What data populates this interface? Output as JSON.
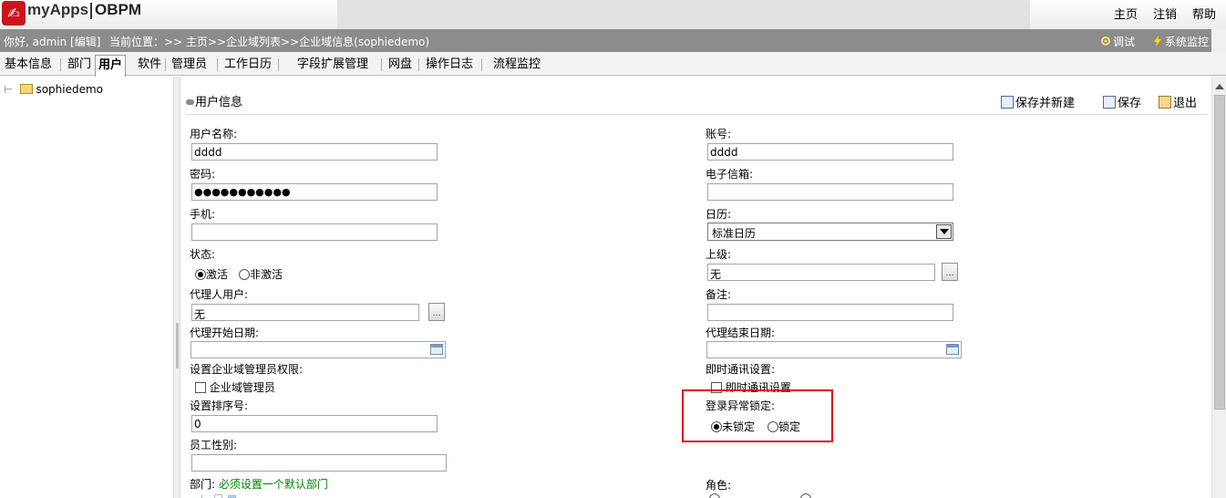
{
  "header": {
    "logo_text": "myApps",
    "product": "OBPM",
    "links": [
      "主页",
      "注销",
      "帮助"
    ]
  },
  "infobar": {
    "greeting": "你好, admin [编辑]",
    "location": "当前位置：>> 主页>>企业域列表>>企业域信息(sophiedemo)",
    "debug": "调试",
    "monitor": "系统监控"
  },
  "tabs": [
    "基本信息",
    "部门",
    "用户",
    "软件",
    "管理员",
    "工作日历",
    "字段扩展管理",
    "网盘",
    "操作日志",
    "流程监控"
  ],
  "active_tab": "用户",
  "tree": {
    "root": "sophiedemo"
  },
  "panel": {
    "title": "用户信息",
    "actions": {
      "save_new": "保存并新建",
      "save": "保存",
      "exit": "退出"
    }
  },
  "form": {
    "username_label": "用户名称:",
    "username_value": "dddd",
    "account_label": "账号:",
    "account_value": "dddd",
    "password_label": "密码:",
    "password_value": "●●●●●●●●●●●",
    "email_label": "电子信箱:",
    "email_value": "",
    "phone_label": "手机:",
    "phone_value": "",
    "calendar_label": "日历:",
    "calendar_value": "标准日历",
    "status_label": "状态:",
    "status_active": "激活",
    "status_inactive": "非激活",
    "superior_label": "上级:",
    "superior_value": "无",
    "proxy_label": "代理人用户:",
    "proxy_value": "无",
    "remark_label": "备注:",
    "remark_value": "",
    "proxy_start_label": "代理开始日期:",
    "proxy_end_label": "代理结束日期:",
    "domain_admin_perm_label": "设置企业域管理员权限:",
    "domain_admin_checkbox": "企业域管理员",
    "im_label": "即时通讯设置:",
    "im_checkbox": "即时通讯设置",
    "sort_label": "设置排序号:",
    "sort_value": "0",
    "lock_label": "登录异常锁定:",
    "lock_unlocked": "未锁定",
    "lock_locked": "锁定",
    "gender_label": "员工性别:",
    "dept_label": "部门:",
    "dept_hint": "必须设置一个默认部门",
    "role_label": "角色:"
  },
  "colors": {
    "highlight": "#e00000",
    "hint": "#008000",
    "infobar": "#8c8c8c"
  }
}
